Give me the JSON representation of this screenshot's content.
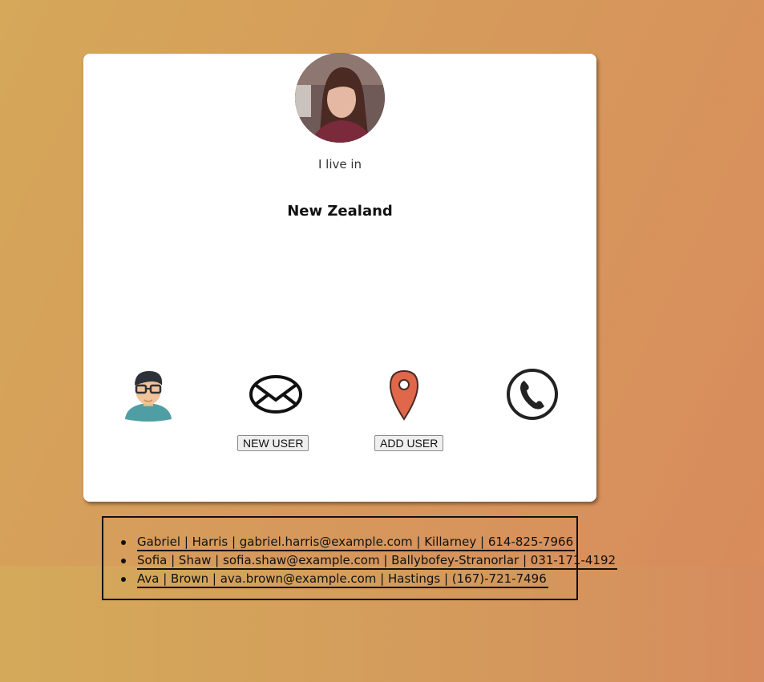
{
  "profile": {
    "intro": "I live in",
    "value": "New Zealand"
  },
  "icons": [
    "user-icon",
    "envelope-icon",
    "map-pin-icon",
    "phone-icon"
  ],
  "buttons": {
    "new_user": "NEW USER",
    "add_user": "ADD USER"
  },
  "users": [
    "Gabriel | Harris | gabriel.harris@example.com | Killarney | 614-825-7966",
    "Sofia | Shaw | sofia.shaw@example.com | Ballybofey-Stranorlar | 031-171-4192",
    "Ava | Brown | ava.brown@example.com | Hastings | (167)-721-7496"
  ],
  "colors": {
    "background_start": "#d5a85a",
    "background_end": "#d98a5c",
    "card": "#ffffff",
    "pin": "#e0674a"
  }
}
